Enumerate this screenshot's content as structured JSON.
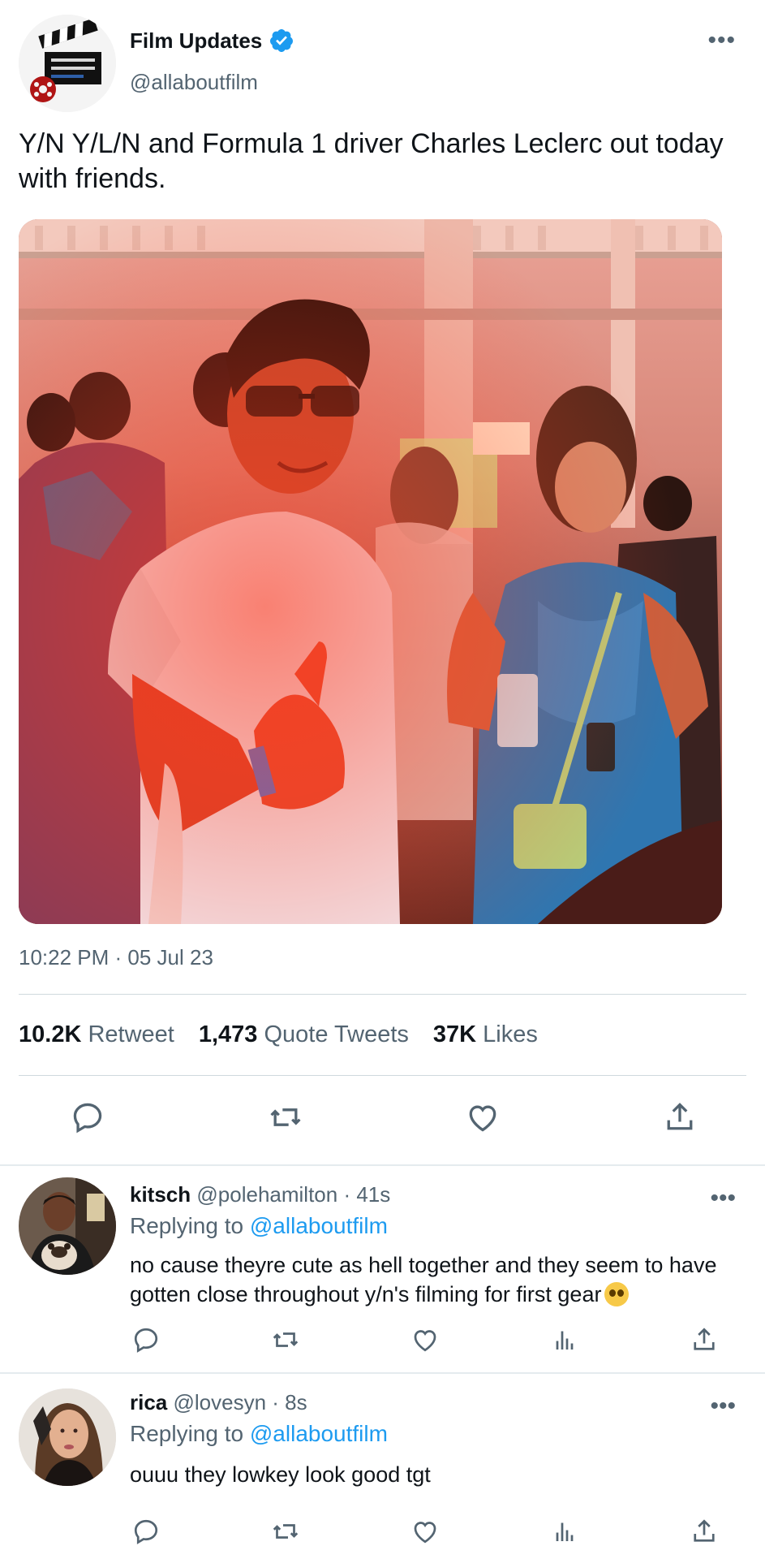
{
  "tweet": {
    "display_name": "Film Updates",
    "handle": "@allaboutfilm",
    "text": "Y/N Y/L/N and Formula 1 driver Charles Leclerc out today with friends.",
    "timestamp": "10:22 PM · 05 Jul 23",
    "stats": {
      "retweets_count": "10.2K",
      "retweets_label": "Retweet",
      "quotes_count": "1,473",
      "quotes_label": "Quote Tweets",
      "likes_count": "37K",
      "likes_label": "Likes"
    }
  },
  "replies": [
    {
      "name": "kitsch",
      "meta": "@polehamilton · 41s",
      "replying_prefix": "Replying to",
      "replying_to": "@allaboutfilm",
      "text": "no cause theyre cute as hell together and they seem to have gotten close throughout y/n's filming for first gear"
    },
    {
      "name": "rica",
      "meta": "@lovesyn · 8s",
      "replying_prefix": "Replying to",
      "replying_to": "@allaboutfilm",
      "text": "ouuu they lowkey look good tgt"
    }
  ],
  "colors": {
    "accent": "#1d9bf0",
    "text": "#0f1419",
    "secondary": "#536471",
    "divider": "#cfd9de"
  },
  "icons": [
    "verified-badge-icon",
    "more-icon",
    "reply-icon",
    "retweet-icon",
    "like-icon",
    "share-icon",
    "analytics-icon",
    "pleading-face-emoji"
  ]
}
